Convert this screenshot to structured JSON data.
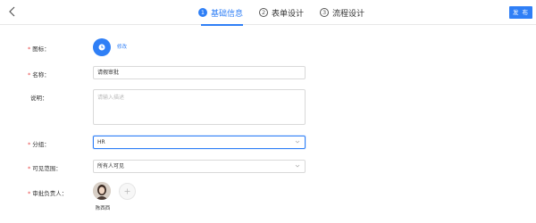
{
  "header": {
    "back_icon": "chevron-left-icon",
    "steps": [
      {
        "num": "1",
        "label": "基础信息",
        "active": true
      },
      {
        "num": "2",
        "label": "表单设计",
        "active": false
      },
      {
        "num": "3",
        "label": "流程设计",
        "active": false
      }
    ],
    "publish_label": "发 布"
  },
  "form": {
    "icon_label": "图标：",
    "icon_edit": "修改",
    "name_label": "名称：",
    "name_value": "请假审批",
    "desc_label": "说明：",
    "desc_placeholder": "请输入描述",
    "group_label": "分组：",
    "group_value": "HR",
    "scope_label": "可见范围：",
    "scope_value": "所有人可见",
    "owner_label": "审批负责人：",
    "owner_name": "陈西西"
  },
  "colors": {
    "accent": "#2f7ff6",
    "required": "#e84a4a"
  }
}
